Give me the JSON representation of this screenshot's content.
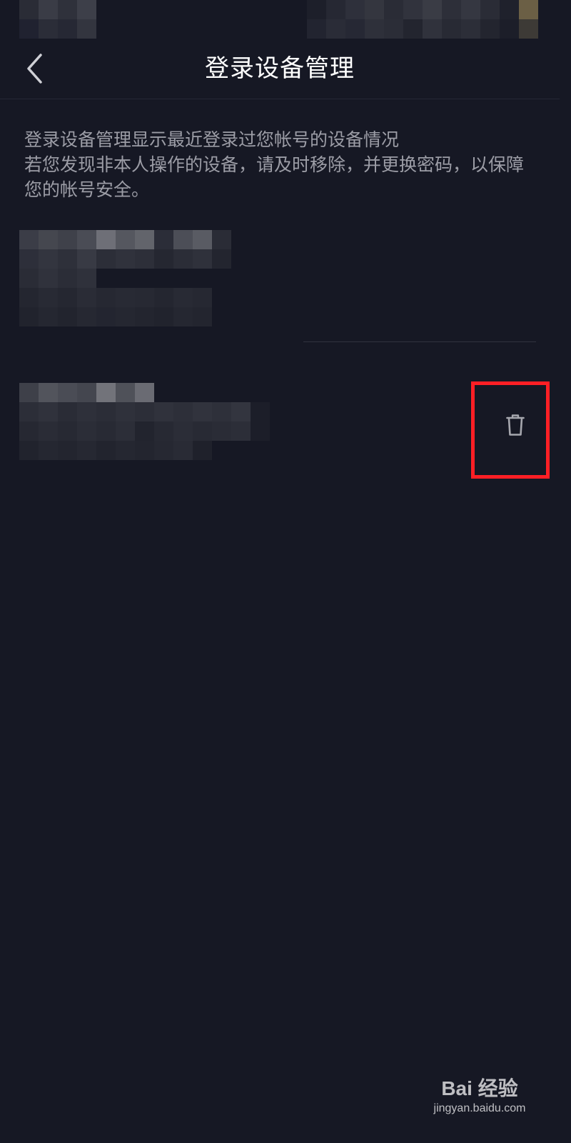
{
  "header": {
    "title": "登录设备管理",
    "back_icon": "chevron-left-icon"
  },
  "description": {
    "line1": "登录设备管理显示最近登录过您帐号的设备情况",
    "line2": "若您发现非本人操作的设备，请及时移除，并更换密码，以保障您的帐号安全。"
  },
  "devices": [
    {
      "name": "",
      "detail": "",
      "time": ""
    },
    {
      "name": "",
      "detail": "",
      "time": "",
      "delete_icon": "trash-icon"
    }
  ],
  "watermark": {
    "brand": "Bai 经验",
    "url": "jingyan.baidu.com"
  },
  "colors": {
    "background": "#161824",
    "text_secondary": "#9c9da6",
    "highlight_border": "#ff1f25"
  }
}
